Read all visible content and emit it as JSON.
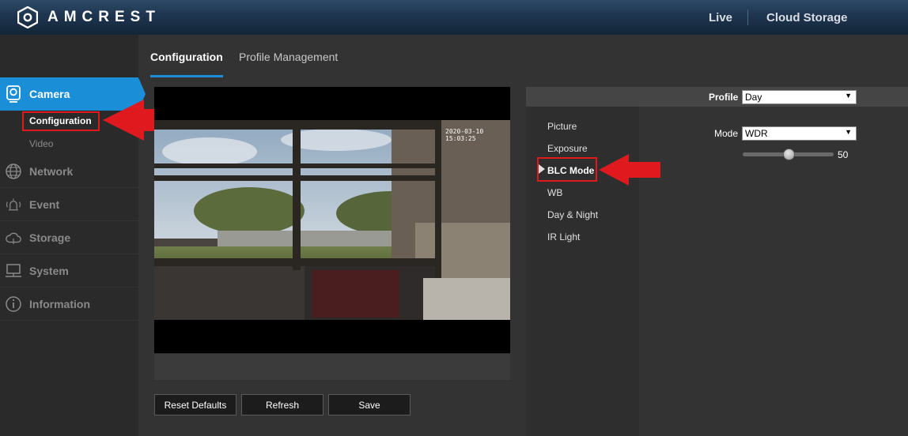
{
  "header": {
    "brand": "AMCREST",
    "nav": [
      "Live",
      "Cloud Storage"
    ]
  },
  "sidebar": {
    "items": [
      {
        "label": "Camera",
        "icon": "camera-icon"
      },
      {
        "label": "Network",
        "icon": "globe-icon"
      },
      {
        "label": "Event",
        "icon": "alarm-icon"
      },
      {
        "label": "Storage",
        "icon": "cloud-icon"
      },
      {
        "label": "System",
        "icon": "monitor-icon"
      },
      {
        "label": "Information",
        "icon": "info-icon"
      }
    ],
    "sub_items": [
      "Configuration",
      "Video"
    ]
  },
  "tabs": [
    "Configuration",
    "Profile Management"
  ],
  "preview": {
    "timestamp": "2020-03-10 15:03:25"
  },
  "buttons": {
    "reset": "Reset Defaults",
    "refresh": "Refresh",
    "save": "Save"
  },
  "settings": {
    "profile_label": "Profile",
    "profile_value": "Day",
    "items": [
      "Picture",
      "Exposure",
      "BLC Mode",
      "WB",
      "Day & Night",
      "IR Light"
    ],
    "active_item": "BLC Mode",
    "mode_label": "Mode",
    "mode_value": "WDR",
    "slider_value": "50",
    "slider_percent": 50
  },
  "colors": {
    "accent": "#1a8fd8",
    "highlight": "#e0191f"
  }
}
